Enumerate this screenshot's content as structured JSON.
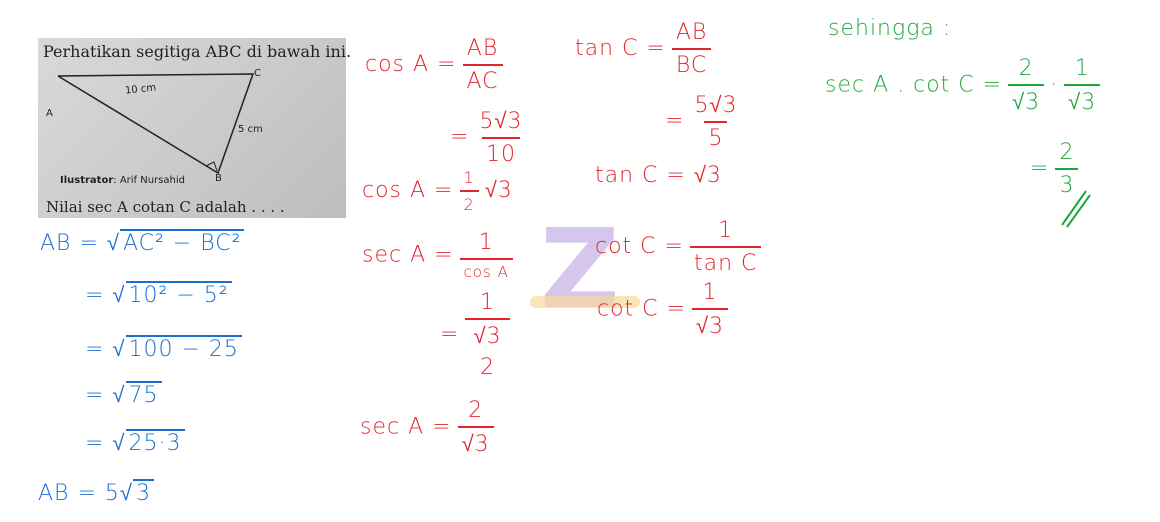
{
  "problem": {
    "title": "Perhatikan segitiga ABC di bawah ini.",
    "vertex_a": "A",
    "vertex_b": "B",
    "vertex_c": "C",
    "side_ac": "10 cm",
    "side_bc": "5 cm",
    "illustrator_label": "Ilustrator",
    "illustrator_name": ": Arif Nursahid",
    "question": "Nilai sec A cotan C adalah . . . ."
  },
  "watermark": "Z",
  "blue": {
    "l1_lhs": "AB =",
    "l1_rad": "AC² − BC²",
    "l2_lhs": "=",
    "l2_rad": "10² − 5²",
    "l3_lhs": "=",
    "l3_rad": "100 − 25",
    "l4_lhs": "=",
    "l4_rad": "75",
    "l5_lhs": "=",
    "l5_rad": "25·3",
    "l6_lhs": "AB = 5",
    "l6_rad": "3"
  },
  "red1": {
    "l1_lhs": "cos A =",
    "l1_num": "AB",
    "l1_den": "AC",
    "l2_lhs": "=",
    "l2_num": "5√3",
    "l2_den": "10",
    "l3_lhs": "cos A =",
    "l3_num": "1",
    "l3_den": "2",
    "l3_rhs": "√3",
    "l4_lhs": "sec A =",
    "l4_num": "1",
    "l4_den": "cos A",
    "l5_lhs": "=",
    "l5_num": "1",
    "l5_den_num": "√3",
    "l5_den_den": "2",
    "l6_lhs": "sec A =",
    "l6_num": "2",
    "l6_den": "√3"
  },
  "red2": {
    "l1_lhs": "tan C =",
    "l1_num": "AB",
    "l1_den": "BC",
    "l2_lhs": "=",
    "l2_num": "5√3",
    "l2_den": "5",
    "l3": "tan C = √3",
    "l4_lhs": "cot C =",
    "l4_num": "1",
    "l4_den": "tan C",
    "l5_lhs": "cot C =",
    "l5_num": "1",
    "l5_den": "√3"
  },
  "green": {
    "l1": "sehingga :",
    "l2_lhs": "sec A . cot C =",
    "l2_n1": "2",
    "l2_d1": "√3",
    "l2_dot": "·",
    "l2_n2": "1",
    "l2_d2": "√3",
    "l3_lhs": "=",
    "l3_num": "2",
    "l3_den": "3"
  },
  "colors": {
    "blue": "#1a6fd1",
    "red": "#e3242b",
    "green": "#1ea53b"
  }
}
